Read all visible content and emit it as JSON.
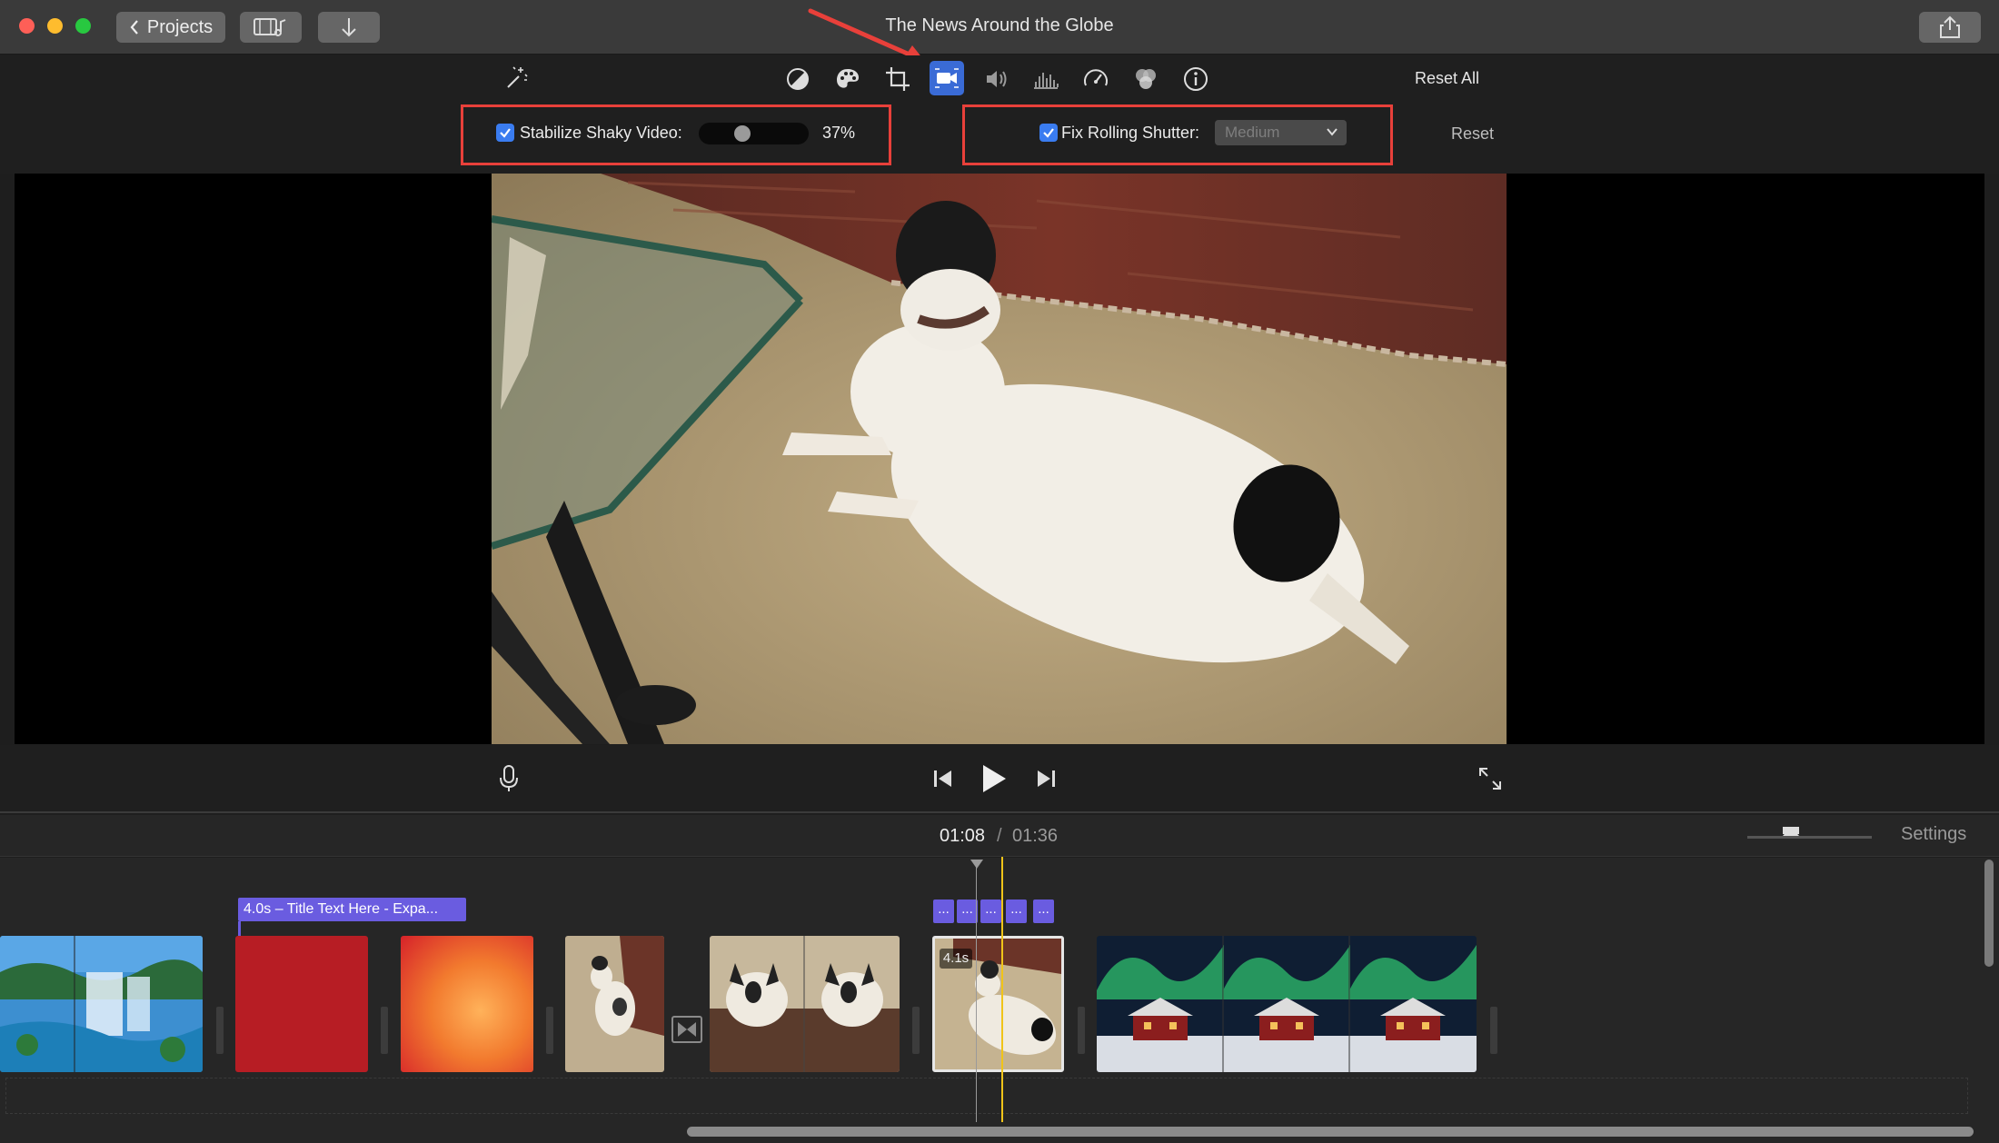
{
  "window": {
    "title": "The News Around the Globe",
    "projects_label": "Projects"
  },
  "toolbar": {
    "reset_all_label": "Reset All",
    "reset_label": "Reset",
    "active_tool": "stabilization",
    "tools": [
      "magic-wand-icon",
      "color-balance-icon",
      "color-correction-icon",
      "crop-icon",
      "stabilization-icon",
      "volume-icon",
      "noise-reduction-icon",
      "speed-icon",
      "clip-filter-icon",
      "info-icon"
    ]
  },
  "stabilization": {
    "stabilize_label": "Stabilize Shaky Video:",
    "stabilize_checked": true,
    "stabilize_level": 0.37,
    "stabilize_value": "37%",
    "rolling_label": "Fix Rolling Shutter:",
    "rolling_checked": true,
    "rolling_value": "Medium"
  },
  "playback": {
    "current_time": "01:08",
    "separator": "/",
    "total_time": "01:36",
    "settings_label": "Settings",
    "zoom_level": 0.35
  },
  "timeline": {
    "title_badge": "4.0s – Title Text Here - Expa...",
    "dots_badges": [
      "...",
      "...",
      "...",
      "...",
      "..."
    ],
    "clip_duration": "4.1s"
  },
  "colors": {
    "accent": "#3a7cf0",
    "highlight": "#e8403a",
    "title_clip": "#6a5ce0",
    "playhead": "#f0c419"
  }
}
